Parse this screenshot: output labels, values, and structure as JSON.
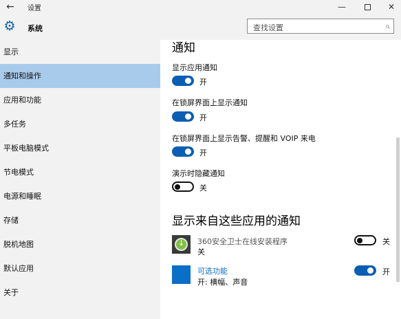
{
  "window": {
    "title": "设置",
    "back_glyph": "←",
    "min_glyph": "—",
    "close_glyph": "✕"
  },
  "header": {
    "section": "系统",
    "search_placeholder": "查找设置"
  },
  "sidebar": {
    "items": [
      {
        "label": "显示"
      },
      {
        "label": "通知和操作"
      },
      {
        "label": "应用和功能"
      },
      {
        "label": "多任务"
      },
      {
        "label": "平板电脑模式"
      },
      {
        "label": "节电模式"
      },
      {
        "label": "电源和睡眠"
      },
      {
        "label": "存储"
      },
      {
        "label": "脱机地图"
      },
      {
        "label": "默认应用"
      },
      {
        "label": "关于"
      }
    ],
    "active_index": 1
  },
  "main": {
    "heading": "通知",
    "settings": [
      {
        "label": "显示应用通知",
        "state": "开",
        "on": true
      },
      {
        "label": "在锁屏界面上显示通知",
        "state": "开",
        "on": true
      },
      {
        "label": "在锁屏界面上显示告警、提醒和 VOIP 来电",
        "state": "开",
        "on": true
      },
      {
        "label": "演示时隐藏通知",
        "state": "关",
        "on": false
      }
    ],
    "apps_heading": "显示来自这些应用的通知",
    "apps": [
      {
        "name": "360安全卫士在线安装程序",
        "sub": "关",
        "state": "关",
        "on": false,
        "icon": "360-installer-icon"
      },
      {
        "name": "可选功能",
        "sub": "开: 横幅、声音",
        "state": "开",
        "on": true,
        "icon": "optional-features-icon"
      }
    ]
  },
  "colors": {
    "accent": "#0a5fb4",
    "sidebar_bg": "#f2f2f2",
    "selected_bg": "#a9cbeb",
    "link": "#0b6fc7"
  }
}
